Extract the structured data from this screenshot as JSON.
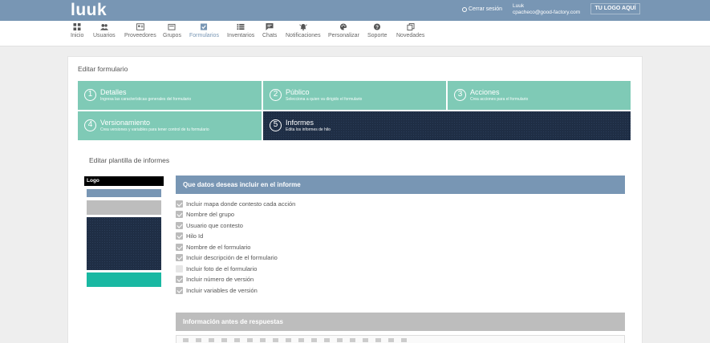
{
  "topbar": {
    "logo": "luuk",
    "logout_label": "Cerrar sesión",
    "user_name": "Luuk",
    "user_email": "cpacheco@good-factory.com",
    "brand_button": "TU LOGO AQUÍ"
  },
  "nav": {
    "items": [
      {
        "label": "Inicio",
        "icon": "grid-icon"
      },
      {
        "label": "Usuarios",
        "icon": "users-icon"
      },
      {
        "label": "Proveedores",
        "icon": "id-card-icon"
      },
      {
        "label": "Grupos",
        "icon": "folder-icon"
      },
      {
        "label": "Formularios",
        "icon": "checkbox-icon",
        "active": true
      },
      {
        "label": "Inventarios",
        "icon": "list-icon"
      },
      {
        "label": "Chats",
        "icon": "chat-icon"
      },
      {
        "label": "Notificaciones",
        "icon": "bell-icon"
      },
      {
        "label": "Personalizar",
        "icon": "palette-icon"
      },
      {
        "label": "Soporte",
        "icon": "help-icon"
      },
      {
        "label": "Novedades",
        "icon": "copy-icon"
      }
    ]
  },
  "page": {
    "title": "Editar formulario",
    "template_title": "Editar plantilla de informes"
  },
  "steps": [
    {
      "num": "1",
      "title": "Detalles",
      "desc": "Ingresa las características generales del formulario"
    },
    {
      "num": "2",
      "title": "Público",
      "desc": "Selecciona a quien va dirigido el formulario"
    },
    {
      "num": "3",
      "title": "Acciones",
      "desc": "Crea acciones para el formulario"
    },
    {
      "num": "4",
      "title": "Versionamiento",
      "desc": "Crea versiones y variables para tener control de tu formulario"
    },
    {
      "num": "5",
      "title": "Informes",
      "desc": "Edita los informes de hilo",
      "active": true
    }
  ],
  "template_preview": {
    "logo_label": "Logo"
  },
  "section_include": {
    "title": "Que datos deseas incluir en el informe",
    "options": [
      {
        "label": "Incluir mapa donde contesto cada acción",
        "checked": true
      },
      {
        "label": "Nombre del grupo",
        "checked": true
      },
      {
        "label": "Usuario que contesto",
        "checked": true
      },
      {
        "label": "Hilo Id",
        "checked": true
      },
      {
        "label": "Nombre de el formulario",
        "checked": true
      },
      {
        "label": "Incluir descripción de el formulario",
        "checked": true
      },
      {
        "label": "Incluir foto de el formulario",
        "checked": false
      },
      {
        "label": "Incluir número de versión",
        "checked": true
      },
      {
        "label": "Incluir variables de versión",
        "checked": true
      }
    ]
  },
  "section_before": {
    "title": "Información antes de respuestas"
  },
  "colors": {
    "topbar": "#7896b4",
    "step_teal": "#7fcab6",
    "step_active": "#1f2e45",
    "accent_teal": "#19b8a2"
  }
}
